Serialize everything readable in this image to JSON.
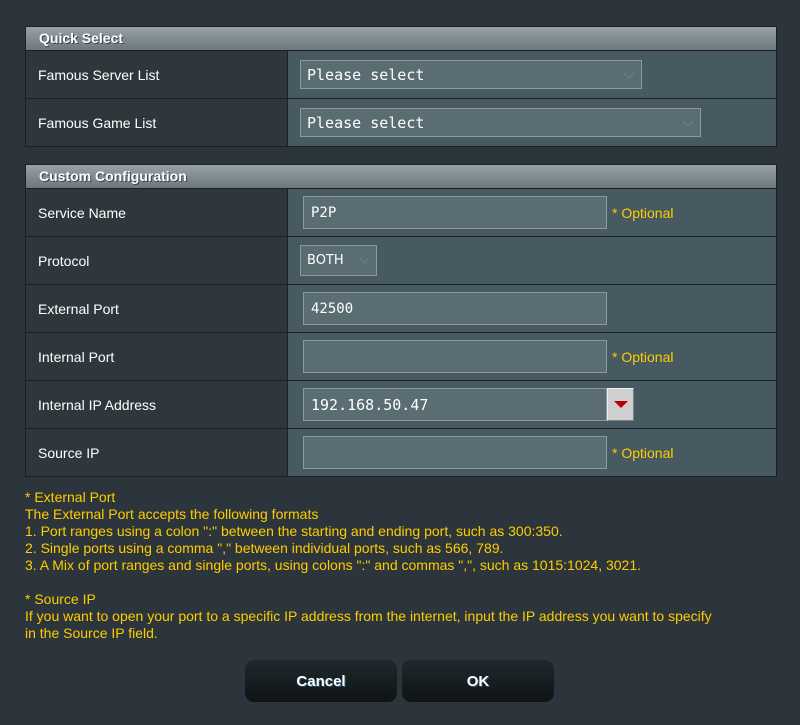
{
  "quick_select": {
    "title": "Quick Select",
    "rows": [
      {
        "label": "Famous Server List",
        "value": "Please select"
      },
      {
        "label": "Famous Game List",
        "value": "Please select"
      }
    ]
  },
  "custom_config": {
    "title": "Custom Configuration",
    "service_name": {
      "label": "Service Name",
      "value": "P2P",
      "hint": "* Optional"
    },
    "protocol": {
      "label": "Protocol",
      "value": "BOTH"
    },
    "external_port": {
      "label": "External Port",
      "value": "42500"
    },
    "internal_port": {
      "label": "Internal Port",
      "value": "",
      "hint": "* Optional"
    },
    "internal_ip": {
      "label": "Internal IP Address",
      "value": "192.168.50.47"
    },
    "source_ip": {
      "label": "Source IP",
      "value": "",
      "hint": "* Optional"
    }
  },
  "notes": {
    "external_port_title": "* External Port",
    "external_port_lines": [
      "The External Port accepts the following formats",
      "1. Port ranges using a colon \":\" between the starting and ending port, such as 300:350.",
      "2. Single ports using a comma \",\" between individual ports, such as 566, 789.",
      "3. A Mix of port ranges and single ports, using colons \":\" and commas \",\", such as 1015:1024, 3021."
    ],
    "source_ip_title": "* Source IP",
    "source_ip_lines": [
      "If you want to open your port to a specific IP address from the internet, input the IP address you want to specify",
      "in the Source IP field."
    ]
  },
  "buttons": {
    "cancel": "Cancel",
    "ok": "OK"
  },
  "colors": {
    "hint": "#ffcc00",
    "dropdown_arrow": "#b80000"
  }
}
